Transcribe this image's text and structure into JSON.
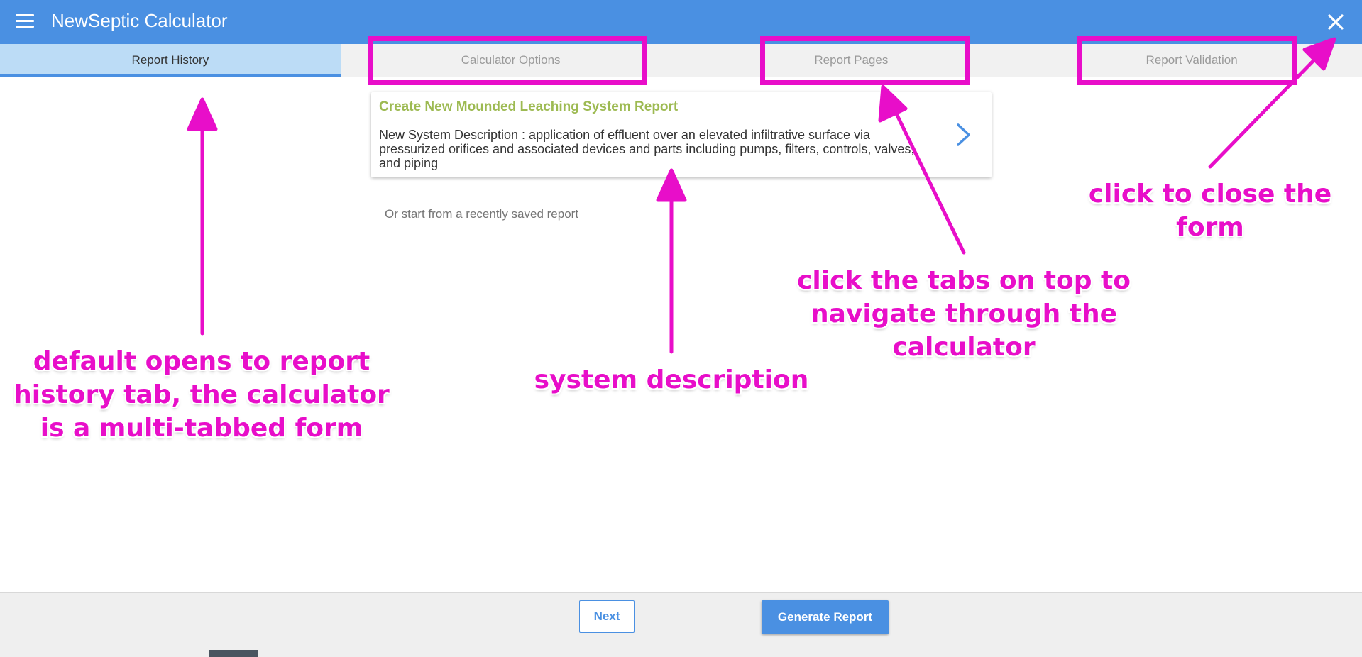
{
  "header": {
    "title": "NewSeptic Calculator",
    "menu_icon": "hamburger-menu-icon",
    "close_icon": "close-icon",
    "background": "#4a90e2"
  },
  "tabs": [
    {
      "label": "Report History",
      "active": true
    },
    {
      "label": "Calculator Options",
      "active": false
    },
    {
      "label": "Report Pages",
      "active": false
    },
    {
      "label": "Report Validation",
      "active": false
    }
  ],
  "card": {
    "title": "Create New Mounded Leaching System Report",
    "description": "New System Description : application of effluent over an elevated infiltrative surface via pressurized orifices and associated devices and parts including pumps, filters, controls, valves, and piping",
    "chevron_icon": "chevron-right-icon"
  },
  "recent_text": "Or start from a recently saved report",
  "footer": {
    "next_label": "Next",
    "generate_label": "Generate Report"
  },
  "annotations": {
    "color": "#e80ec9",
    "report_history": "default opens to report history tab, the calculator is a multi-tabbed form",
    "system_description": "system description",
    "tabs_navigation": "click the tabs on top to navigate through the calculator",
    "close_form": "click to close the form"
  },
  "colors": {
    "accent": "#4a90e2",
    "active_tab": "#bcdcf6",
    "card_title": "#9dba52"
  }
}
